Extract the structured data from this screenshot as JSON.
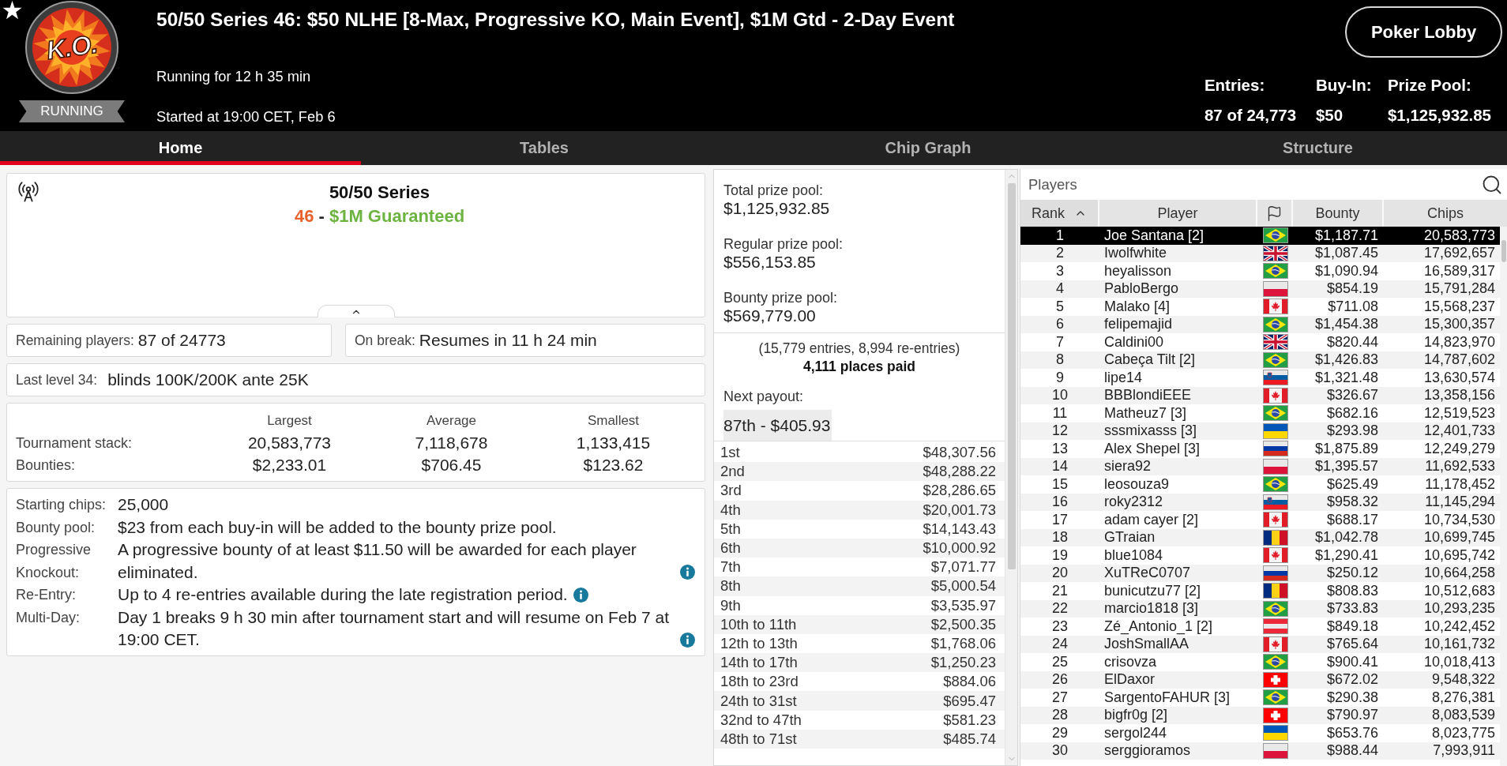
{
  "header": {
    "logo_text": "K.O.",
    "status": "RUNNING",
    "title": "50/50 Series 46: $50 NLHE [8-Max, Progressive KO, Main Event], $1M Gtd - 2-Day Event",
    "running_for": "Running for 12 h 35 min",
    "started_at": "Started at 19:00 CET, Feb 6",
    "lobby_button": "Poker Lobby",
    "stats": [
      {
        "label": "Entries:",
        "value": "87 of 24,773"
      },
      {
        "label": "Buy-In:",
        "value": "$50"
      },
      {
        "label": "Prize Pool:",
        "value": "$1,125,932.85"
      }
    ]
  },
  "tabs": [
    {
      "label": "Home",
      "selected": true
    },
    {
      "label": "Tables",
      "selected": false
    },
    {
      "label": "Chip Graph",
      "selected": false
    },
    {
      "label": "Structure",
      "selected": false
    }
  ],
  "series_card": {
    "title": "50/50 Series",
    "subtitle": [
      {
        "text": "46",
        "color": "#e8612c"
      },
      {
        "text": " - ",
        "color": "#222222"
      },
      {
        "text": "$1M Guaranteed",
        "color": "#6cb33f"
      }
    ]
  },
  "remaining": {
    "label": "Remaining players:",
    "value": "87 of 24773"
  },
  "on_break": {
    "label": "On break:",
    "value": "Resumes in 11 h 24 min"
  },
  "last_level": {
    "label": "Last level 34:",
    "value": "blinds 100K/200K ante 25K"
  },
  "stacks": {
    "columns": [
      "Largest",
      "Average",
      "Smallest"
    ],
    "rows": [
      {
        "label": "Tournament stack:",
        "values": [
          "20,583,773",
          "7,118,678",
          "1,133,415"
        ]
      },
      {
        "label": "Bounties:",
        "values": [
          "$2,233.01",
          "$706.45",
          "$123.62"
        ]
      }
    ]
  },
  "details": [
    {
      "label": "Starting chips:",
      "value": "25,000",
      "info": false
    },
    {
      "label": "Bounty pool:",
      "value": "$23 from each buy-in will be added to the bounty prize pool.",
      "info": false
    },
    {
      "label": "Progressive Knockout:",
      "value": "A progressive bounty of at least $11.50 will be awarded for each player eliminated.",
      "info": true
    },
    {
      "label": "Re-Entry:",
      "value": "Up to 4 re-entries available during the late registration period.",
      "info": true
    },
    {
      "label": "Multi-Day:",
      "value": "Day 1 breaks 9 h 30 min after tournament start and will resume on Feb 7 at 19:00 CET.",
      "info": true
    }
  ],
  "prize_pools": [
    {
      "label": "Total prize pool:",
      "value": "$1,125,932.85"
    },
    {
      "label": "Regular prize pool:",
      "value": "$556,153.85"
    },
    {
      "label": "Bounty prize pool:",
      "value": "$569,779.00"
    }
  ],
  "entries_note": "(15,779 entries, 8,994 re-entries)",
  "places_paid": "4,111 places paid",
  "next_payout": {
    "label": "Next payout:",
    "value": "87th - $405.93"
  },
  "payouts": [
    {
      "place": "1st",
      "amount": "$48,307.56"
    },
    {
      "place": "2nd",
      "amount": "$48,288.22"
    },
    {
      "place": "3rd",
      "amount": "$28,286.65"
    },
    {
      "place": "4th",
      "amount": "$20,001.73"
    },
    {
      "place": "5th",
      "amount": "$14,143.43"
    },
    {
      "place": "6th",
      "amount": "$10,000.92"
    },
    {
      "place": "7th",
      "amount": "$7,071.77"
    },
    {
      "place": "8th",
      "amount": "$5,000.54"
    },
    {
      "place": "9th",
      "amount": "$3,535.97"
    },
    {
      "place": "10th to 11th",
      "amount": "$2,500.35"
    },
    {
      "place": "12th to 13th",
      "amount": "$1,768.06"
    },
    {
      "place": "14th to 17th",
      "amount": "$1,250.23"
    },
    {
      "place": "18th to 23rd",
      "amount": "$884.06"
    },
    {
      "place": "24th to 31st",
      "amount": "$695.47"
    },
    {
      "place": "32nd to 47th",
      "amount": "$581.23"
    },
    {
      "place": "48th to 71st",
      "amount": "$485.74"
    }
  ],
  "players": {
    "title": "Players",
    "columns": [
      {
        "kind": "text",
        "label": "Rank",
        "sorted": true
      },
      {
        "kind": "text",
        "label": "Player",
        "sorted": false
      },
      {
        "kind": "icon",
        "sorted": false
      },
      {
        "kind": "text",
        "label": "Bounty",
        "sorted": false
      },
      {
        "kind": "text",
        "label": "Chips",
        "sorted": false
      }
    ],
    "rows": [
      {
        "rank": "1",
        "player": "Joe Santana [2]",
        "flag": {
          "kind": "brazil"
        },
        "bounty": "$1,187.71",
        "chips": "20,583,773",
        "selected": true
      },
      {
        "rank": "2",
        "player": "Iwolfwhite",
        "flag": {
          "kind": "uk"
        },
        "bounty": "$1,087.45",
        "chips": "17,692,657",
        "selected": false
      },
      {
        "rank": "3",
        "player": "heyalisson",
        "flag": {
          "kind": "brazil"
        },
        "bounty": "$1,090.94",
        "chips": "16,589,317",
        "selected": false
      },
      {
        "rank": "4",
        "player": "PabloBergo",
        "flag": {
          "kind": "poland"
        },
        "bounty": "$854.19",
        "chips": "15,791,284",
        "selected": false
      },
      {
        "rank": "5",
        "player": "Malako [4]",
        "flag": {
          "kind": "canada"
        },
        "bounty": "$711.08",
        "chips": "15,568,237",
        "selected": false
      },
      {
        "rank": "6",
        "player": "felipemajid",
        "flag": {
          "kind": "brazil"
        },
        "bounty": "$1,454.38",
        "chips": "15,300,357",
        "selected": false
      },
      {
        "rank": "7",
        "player": "Caldini00",
        "flag": {
          "kind": "uk"
        },
        "bounty": "$820.44",
        "chips": "14,823,970",
        "selected": false
      },
      {
        "rank": "8",
        "player": "Cabeça Tilt [2]",
        "flag": {
          "kind": "brazil"
        },
        "bounty": "$1,426.83",
        "chips": "14,787,602",
        "selected": false
      },
      {
        "rank": "9",
        "player": "lipe14",
        "flag": {
          "kind": "slovenia"
        },
        "bounty": "$1,321.48",
        "chips": "13,630,574",
        "selected": false
      },
      {
        "rank": "10",
        "player": "BBBlondiEEE",
        "flag": {
          "kind": "canada"
        },
        "bounty": "$326.67",
        "chips": "13,358,156",
        "selected": false
      },
      {
        "rank": "11",
        "player": "Matheuz7 [3]",
        "flag": {
          "kind": "brazil"
        },
        "bounty": "$682.16",
        "chips": "12,519,523",
        "selected": false
      },
      {
        "rank": "12",
        "player": "sssmixasss [3]",
        "flag": {
          "kind": "ukraine"
        },
        "bounty": "$293.98",
        "chips": "12,401,733",
        "selected": false
      },
      {
        "rank": "13",
        "player": "Alex Shepel [3]",
        "flag": {
          "kind": "russia"
        },
        "bounty": "$1,875.89",
        "chips": "12,249,279",
        "selected": false
      },
      {
        "rank": "14",
        "player": "siera92",
        "flag": {
          "kind": "poland"
        },
        "bounty": "$1,395.57",
        "chips": "11,692,533",
        "selected": false
      },
      {
        "rank": "15",
        "player": "leosouza9",
        "flag": {
          "kind": "brazil"
        },
        "bounty": "$625.49",
        "chips": "11,178,452",
        "selected": false
      },
      {
        "rank": "16",
        "player": "roky2312",
        "flag": {
          "kind": "slovenia"
        },
        "bounty": "$958.32",
        "chips": "11,145,294",
        "selected": false
      },
      {
        "rank": "17",
        "player": "adam cayer [2]",
        "flag": {
          "kind": "canada"
        },
        "bounty": "$688.17",
        "chips": "10,734,530",
        "selected": false
      },
      {
        "rank": "18",
        "player": "GTraian",
        "flag": {
          "kind": "romania"
        },
        "bounty": "$1,042.78",
        "chips": "10,699,745",
        "selected": false
      },
      {
        "rank": "19",
        "player": "blue1084",
        "flag": {
          "kind": "canada"
        },
        "bounty": "$1,290.41",
        "chips": "10,695,742",
        "selected": false
      },
      {
        "rank": "20",
        "player": "XuTReC0707",
        "flag": {
          "kind": "russia"
        },
        "bounty": "$250.12",
        "chips": "10,664,258",
        "selected": false
      },
      {
        "rank": "21",
        "player": "bunicutzu77 [2]",
        "flag": {
          "kind": "romania"
        },
        "bounty": "$808.83",
        "chips": "10,512,683",
        "selected": false
      },
      {
        "rank": "22",
        "player": "marcio1818 [3]",
        "flag": {
          "kind": "brazil"
        },
        "bounty": "$733.83",
        "chips": "10,293,235",
        "selected": false
      },
      {
        "rank": "23",
        "player": "Zé_Antonio_1 [2]",
        "flag": {
          "kind": "austria"
        },
        "bounty": "$849.18",
        "chips": "10,242,452",
        "selected": false
      },
      {
        "rank": "24",
        "player": "JoshSmallAA",
        "flag": {
          "kind": "canada"
        },
        "bounty": "$765.64",
        "chips": "10,161,732",
        "selected": false
      },
      {
        "rank": "25",
        "player": "crisovza",
        "flag": {
          "kind": "brazil"
        },
        "bounty": "$900.41",
        "chips": "10,018,413",
        "selected": false
      },
      {
        "rank": "26",
        "player": "ElDaxor",
        "flag": {
          "kind": "switzerland"
        },
        "bounty": "$672.02",
        "chips": "9,548,322",
        "selected": false
      },
      {
        "rank": "27",
        "player": "SargentoFAHUR [3]",
        "flag": {
          "kind": "brazil"
        },
        "bounty": "$290.38",
        "chips": "8,276,381",
        "selected": false
      },
      {
        "rank": "28",
        "player": "bigfr0g [2]",
        "flag": {
          "kind": "switzerland"
        },
        "bounty": "$790.97",
        "chips": "8,083,539",
        "selected": false
      },
      {
        "rank": "29",
        "player": "sergol244",
        "flag": {
          "kind": "ukraine"
        },
        "bounty": "$653.76",
        "chips": "8,023,775",
        "selected": false
      },
      {
        "rank": "30",
        "player": "serggioramos",
        "flag": {
          "kind": "poland"
        },
        "bounty": "$988.44",
        "chips": "7,993,911",
        "selected": false
      }
    ]
  }
}
